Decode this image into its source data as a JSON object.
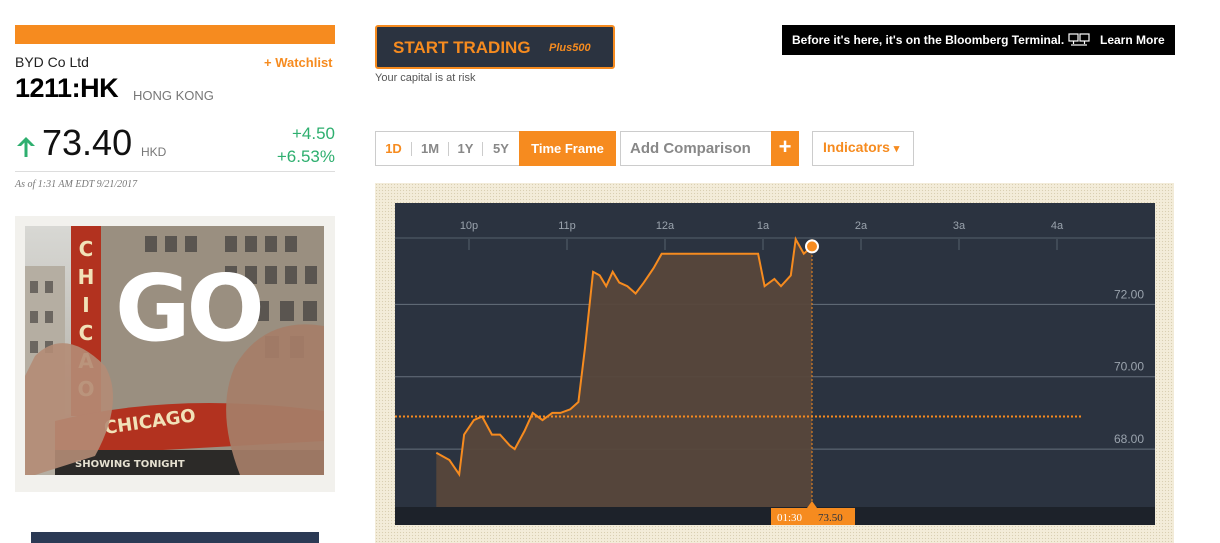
{
  "quote": {
    "company_name": "BYD Co Ltd",
    "watchlist_label": "+ Watchlist",
    "ticker": "1211:HK",
    "exchange": "HONG KONG",
    "direction_icon": "up-arrow-icon",
    "price": "73.40",
    "currency": "HKD",
    "change_abs": "+4.50",
    "change_pct": "+6.53%",
    "as_of": "As of 1:31 AM EDT 9/21/2017",
    "positive_color": "#2eaf6f",
    "accent_color": "#f68b1f"
  },
  "ads": {
    "side_ad_text": "GO",
    "side_ad_sign": "CHICAGO",
    "side_ad_marquee": "SHOWING TONIGHT",
    "trading_button": "START TRADING",
    "trading_brand": "Plus500",
    "risk_text": "Your capital is at risk",
    "terminal_text": "Before it's here, it's on the Bloomberg Terminal.",
    "terminal_icon": "monitor-icon",
    "learn_more": "Learn More"
  },
  "toolbar": {
    "ranges": [
      "1D",
      "1M",
      "1Y",
      "5Y"
    ],
    "active_range": "1D",
    "time_frame": "Time Frame",
    "comparison_placeholder": "Add Comparison",
    "comparison_add": "+",
    "indicators": "Indicators",
    "indicators_caret": "▾"
  },
  "chart_data": {
    "type": "area",
    "x_tick_labels": [
      "10p",
      "11p",
      "12a",
      "1a",
      "2a",
      "3a",
      "4a"
    ],
    "y_tick_labels": [
      "72.00",
      "70.00",
      "68.00"
    ],
    "ylim": [
      66.4,
      74.8
    ],
    "previous_close": 68.9,
    "crosshair": {
      "time": "01:30",
      "value": "73.50"
    },
    "series": [
      {
        "x": [
          "21:40",
          "21:48",
          "21:54",
          "21:57",
          "22:03",
          "22:08",
          "22:14",
          "22:19",
          "22:25",
          "22:28",
          "22:34",
          "22:39",
          "22:45",
          "22:51",
          "22:56",
          "23:02",
          "23:07",
          "23:11",
          "23:16",
          "23:20",
          "23:24",
          "23:28",
          "23:32",
          "23:37",
          "23:42",
          "23:47",
          "23:53",
          "23:58",
          "24:03",
          "24:30",
          "24:52",
          "24:57",
          "25:01",
          "25:07",
          "25:11",
          "25:17",
          "25:20",
          "25:25",
          "25:30"
        ],
        "values": [
          67.9,
          67.7,
          67.3,
          68.4,
          68.8,
          68.9,
          68.4,
          68.4,
          68.1,
          68.0,
          68.5,
          69.0,
          68.8,
          69.0,
          69.0,
          69.1,
          69.3,
          70.8,
          72.9,
          72.8,
          72.5,
          72.9,
          72.6,
          72.5,
          72.3,
          72.6,
          73.0,
          73.4,
          73.4,
          73.4,
          73.4,
          73.4,
          72.5,
          72.7,
          72.5,
          72.8,
          73.8,
          73.4,
          73.6
        ]
      }
    ],
    "line_color": "#f68b1f",
    "background": "#2b3340",
    "grid": true
  }
}
